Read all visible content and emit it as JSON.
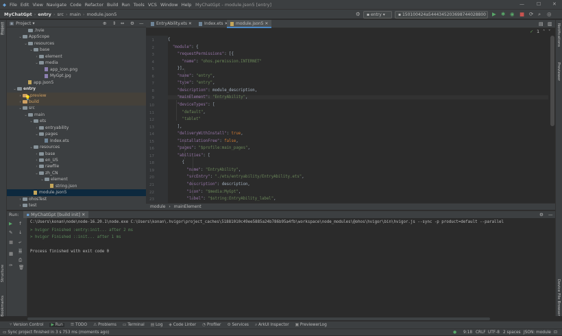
{
  "window": {
    "title": "MyChatGpt - module.json5 [entry]"
  },
  "menu": [
    "File",
    "Edit",
    "View",
    "Navigate",
    "Code",
    "Refactor",
    "Build",
    "Run",
    "Tools",
    "VCS",
    "Window",
    "Help"
  ],
  "nav": {
    "project": "MyChatGpt",
    "module": "entry",
    "src": "src",
    "main": "main",
    "file": "module.json5",
    "run_config": "entry",
    "device": "150100424a5444345203698744028800"
  },
  "strips": {
    "left_top": "Project",
    "left_structure": "Structure",
    "left_bookmarks": "Bookmarks",
    "right_notifications": "Notifications",
    "right_previewer": "Previewer",
    "right_device": "Device File Browser"
  },
  "project_panel": {
    "title": "Project"
  },
  "tree": [
    {
      "indent": 3,
      "arrow": "",
      "icon": "folder",
      "label": ".hvie",
      "state": ""
    },
    {
      "indent": 2,
      "arrow": "v",
      "icon": "folder",
      "label": "AppScope",
      "state": ""
    },
    {
      "indent": 3,
      "arrow": "v",
      "icon": "folder",
      "label": "resources",
      "state": ""
    },
    {
      "indent": 4,
      "arrow": "v",
      "icon": "folder",
      "label": "base",
      "state": ""
    },
    {
      "indent": 5,
      "arrow": ">",
      "icon": "folder",
      "label": "element",
      "state": ""
    },
    {
      "indent": 5,
      "arrow": "v",
      "icon": "folder",
      "label": "media",
      "state": ""
    },
    {
      "indent": 6,
      "arrow": "",
      "icon": "img",
      "label": "app_icon.png",
      "state": ""
    },
    {
      "indent": 6,
      "arrow": "",
      "icon": "img",
      "label": "MyGpt.jpg",
      "state": ""
    },
    {
      "indent": 3,
      "arrow": "",
      "icon": "json",
      "label": "app.json5",
      "state": ""
    },
    {
      "indent": 1,
      "arrow": "v",
      "icon": "folder",
      "label": "entry",
      "state": "bold"
    },
    {
      "indent": 2,
      "arrow": ">",
      "icon": "orange",
      "label": ".preview",
      "state": "hl"
    },
    {
      "indent": 2,
      "arrow": ">",
      "icon": "orange",
      "label": "build",
      "state": "hl"
    },
    {
      "indent": 2,
      "arrow": "v",
      "icon": "folder",
      "label": "src",
      "state": ""
    },
    {
      "indent": 3,
      "arrow": "v",
      "icon": "folder",
      "label": "main",
      "state": ""
    },
    {
      "indent": 4,
      "arrow": "v",
      "icon": "folder",
      "label": "ets",
      "state": ""
    },
    {
      "indent": 5,
      "arrow": ">",
      "icon": "folder",
      "label": "entryability",
      "state": ""
    },
    {
      "indent": 5,
      "arrow": "v",
      "icon": "folder",
      "label": "pages",
      "state": ""
    },
    {
      "indent": 6,
      "arrow": "",
      "icon": "file",
      "label": "Index.ets",
      "state": ""
    },
    {
      "indent": 4,
      "arrow": "v",
      "icon": "folder",
      "label": "resources",
      "state": ""
    },
    {
      "indent": 5,
      "arrow": ">",
      "icon": "folder",
      "label": "base",
      "state": ""
    },
    {
      "indent": 5,
      "arrow": ">",
      "icon": "folder",
      "label": "en_US",
      "state": ""
    },
    {
      "indent": 5,
      "arrow": ">",
      "icon": "folder",
      "label": "rawfile",
      "state": ""
    },
    {
      "indent": 5,
      "arrow": "v",
      "icon": "folder",
      "label": "zh_CN",
      "state": ""
    },
    {
      "indent": 6,
      "arrow": "v",
      "icon": "folder",
      "label": "element",
      "state": ""
    },
    {
      "indent": 7,
      "arrow": "",
      "icon": "json",
      "label": "string.json",
      "state": ""
    },
    {
      "indent": 4,
      "arrow": "",
      "icon": "json",
      "label": "module.json5",
      "state": "sel"
    },
    {
      "indent": 2,
      "arrow": ">",
      "icon": "folder",
      "label": "ohosTest",
      "state": ""
    },
    {
      "indent": 2,
      "arrow": ">",
      "icon": "folder",
      "label": "test",
      "state": ""
    }
  ],
  "editor_tabs": [
    "EntryAbility.ets",
    "Index.ets",
    "module.json5"
  ],
  "editor": {
    "inspection": "1",
    "breadcrumb_module": "module",
    "breadcrumb_main": "mainElement"
  },
  "code_lines": [
    {
      "n": "1",
      "t": [
        [
          "pun",
          "{"
        ]
      ]
    },
    {
      "n": "2",
      "t": [
        [
          "pun",
          "  "
        ],
        [
          "key",
          "\"module\""
        ],
        [
          "pun",
          ": {"
        ]
      ]
    },
    {
      "n": "3",
      "t": [
        [
          "pun",
          "    "
        ],
        [
          "key",
          "\"requestPermissions\""
        ],
        [
          "pun",
          ": [{"
        ]
      ]
    },
    {
      "n": "4",
      "t": [
        [
          "pun",
          "      "
        ],
        [
          "key",
          "\"name\""
        ],
        [
          "pun",
          ": "
        ],
        [
          "str",
          "\"ohos.permission.INTERNET\""
        ]
      ]
    },
    {
      "n": "5",
      "t": [
        [
          "pun",
          "    }],"
        ]
      ]
    },
    {
      "n": "6",
      "t": [
        [
          "pun",
          "    "
        ],
        [
          "key",
          "\"name\""
        ],
        [
          "pun",
          ": "
        ],
        [
          "str",
          "\"entry\""
        ],
        [
          "pun",
          ","
        ]
      ]
    },
    {
      "n": "7",
      "t": [
        [
          "pun",
          "    "
        ],
        [
          "key",
          "\"type\""
        ],
        [
          "pun",
          ": "
        ],
        [
          "str",
          "\"entry\""
        ],
        [
          "pun",
          ","
        ]
      ]
    },
    {
      "n": "8",
      "t": [
        [
          "pun",
          "    "
        ],
        [
          "key",
          "\"description\""
        ],
        [
          "pun",
          ": module_description,"
        ]
      ]
    },
    {
      "n": "9",
      "t": [
        [
          "pun",
          "    "
        ],
        [
          "key",
          "\"mainElement\""
        ],
        [
          "pun",
          ": "
        ],
        [
          "str",
          "\"EntryAbility\""
        ],
        [
          "pun",
          ","
        ]
      ],
      "hl": true
    },
    {
      "n": "10",
      "t": [
        [
          "pun",
          "    "
        ],
        [
          "key",
          "\"deviceTypes\""
        ],
        [
          "pun",
          ": ["
        ]
      ]
    },
    {
      "n": "11",
      "t": [
        [
          "pun",
          "      "
        ],
        [
          "str",
          "\"default\""
        ],
        [
          "pun",
          ","
        ]
      ]
    },
    {
      "n": "12",
      "t": [
        [
          "pun",
          "      "
        ],
        [
          "str",
          "\"tablet\""
        ]
      ]
    },
    {
      "n": "13",
      "t": [
        [
          "pun",
          "    ],"
        ]
      ]
    },
    {
      "n": "14",
      "t": [
        [
          "pun",
          "    "
        ],
        [
          "key",
          "\"deliveryWithInstall\""
        ],
        [
          "pun",
          ": "
        ],
        [
          "kw",
          "true"
        ],
        [
          "pun",
          ","
        ]
      ]
    },
    {
      "n": "15",
      "t": [
        [
          "pun",
          "    "
        ],
        [
          "key",
          "\"installationFree\""
        ],
        [
          "pun",
          ": "
        ],
        [
          "kw",
          "false"
        ],
        [
          "pun",
          ","
        ]
      ]
    },
    {
      "n": "16",
      "t": [
        [
          "pun",
          "    "
        ],
        [
          "key",
          "\"pages\""
        ],
        [
          "pun",
          ": "
        ],
        [
          "str",
          "\"$profile:main_pages\""
        ],
        [
          "pun",
          ","
        ]
      ]
    },
    {
      "n": "17",
      "t": [
        [
          "pun",
          "    "
        ],
        [
          "key",
          "\"abilities\""
        ],
        [
          "pun",
          ": ["
        ]
      ]
    },
    {
      "n": "18",
      "t": [
        [
          "pun",
          "      {"
        ]
      ]
    },
    {
      "n": "19",
      "t": [
        [
          "pun",
          "        "
        ],
        [
          "key",
          "\"name\""
        ],
        [
          "pun",
          ": "
        ],
        [
          "str",
          "\"EntryAbility\""
        ],
        [
          "pun",
          ","
        ]
      ]
    },
    {
      "n": "20",
      "t": [
        [
          "pun",
          "        "
        ],
        [
          "key",
          "\"srcEntry\""
        ],
        [
          "pun",
          ": "
        ],
        [
          "str",
          "\"./ets/entryability/EntryAbility.ets\""
        ],
        [
          "pun",
          ","
        ]
      ]
    },
    {
      "n": "21",
      "t": [
        [
          "pun",
          "        "
        ],
        [
          "key",
          "\"description\""
        ],
        [
          "pun",
          ": description,"
        ]
      ]
    },
    {
      "n": "22",
      "t": [
        [
          "pun",
          "        "
        ],
        [
          "key",
          "\"icon\""
        ],
        [
          "pun",
          ": "
        ],
        [
          "str",
          "\"$media:MyGpt\""
        ],
        [
          "pun",
          ","
        ]
      ]
    },
    {
      "n": "23",
      "t": [
        [
          "pun",
          "        "
        ],
        [
          "key",
          "\"label\""
        ],
        [
          "pun",
          ": "
        ],
        [
          "str",
          "\"$string:EntryAbility_label\""
        ],
        [
          "pun",
          ","
        ]
      ]
    }
  ],
  "run": {
    "label": "Run:",
    "tab": "MyChatGpt [build init]",
    "lines": [
      {
        "c": "",
        "t": "C:\\Users\\konan\\node\\node-16.20.1\\node.exe C:\\Users\\konan\\.hvigor\\project_caches\\51881010c49ee5885a24b786b95a4fb\\workspace\\node_modules\\@ohos\\hvigor\\bin\\hvigor.js --sync -p product=default --parallel"
      },
      {
        "c": "gr",
        "t": "> hvigor Finished :entry:init... after 2 ms"
      },
      {
        "c": "gr",
        "t": "> hvigor Finished ::init... after 1 ms"
      },
      {
        "c": "",
        "t": ""
      },
      {
        "c": "",
        "t": "Process finished with exit code 0"
      }
    ]
  },
  "bottom_tools": [
    "Version Control",
    "Run",
    "TODO",
    "Problems",
    "Terminal",
    "Log",
    "Code Linter",
    "Profiler",
    "Services",
    "ArkUI Inspector",
    "PreviewerLog"
  ],
  "status": {
    "message": "Sync project finished in 3 s 753 ms (moments ago)",
    "position": "9:18",
    "line_sep": "CRLF",
    "encoding": "UTF-8",
    "indent": "2 spaces",
    "schema": "JSON: module"
  }
}
